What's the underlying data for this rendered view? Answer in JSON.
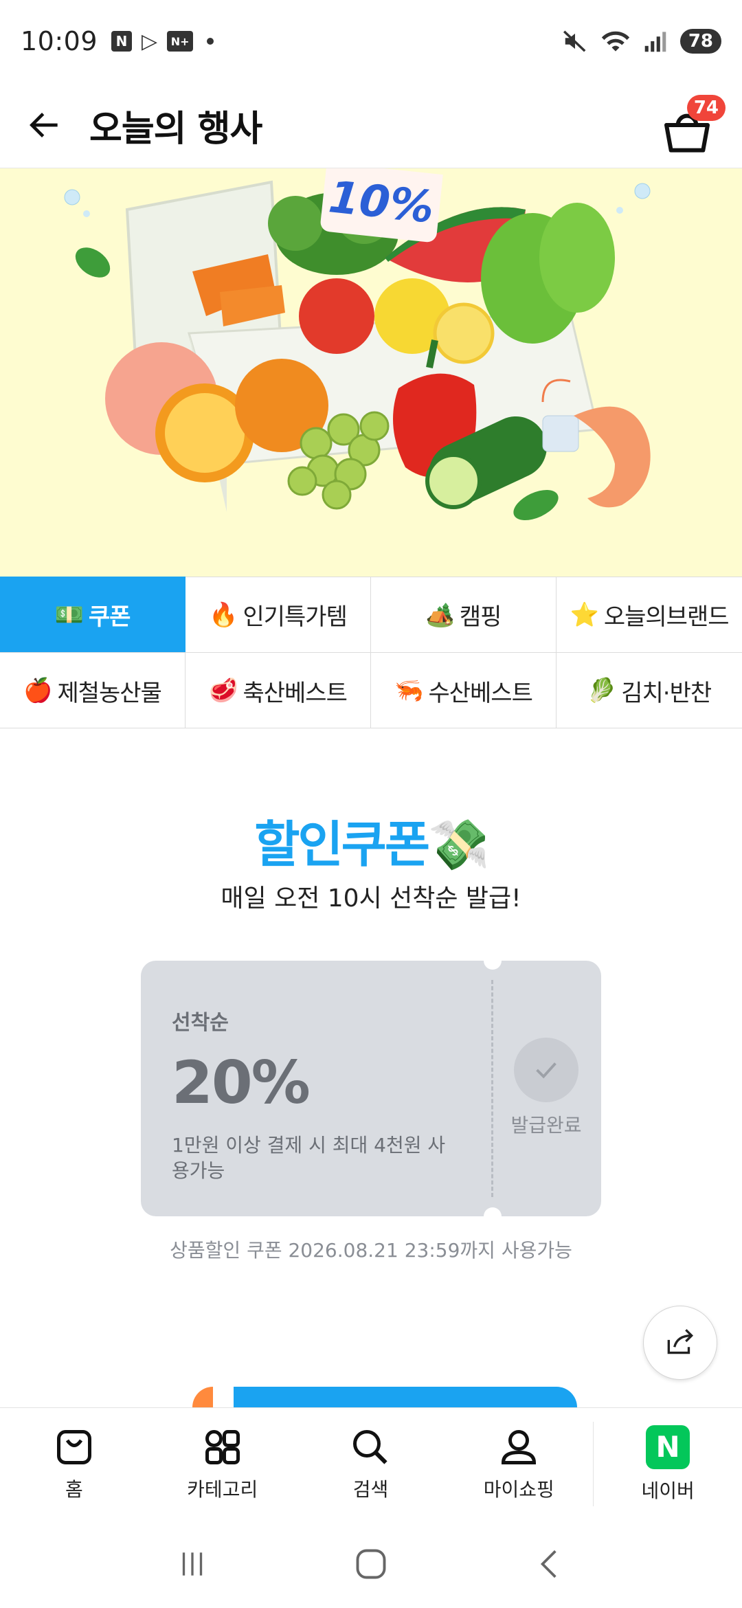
{
  "status_bar": {
    "time": "10:09",
    "notif_icons": [
      "N",
      "▷",
      "N+"
    ],
    "battery": "78"
  },
  "header": {
    "title": "오늘의 행사",
    "cart_count": "74"
  },
  "banner": {
    "discount_tag": "10%"
  },
  "categories": [
    {
      "emoji": "💵",
      "label": "쿠폰",
      "active": true
    },
    {
      "emoji": "🔥",
      "label": "인기특가템",
      "active": false
    },
    {
      "emoji": "🏕️",
      "label": "캠핑",
      "active": false
    },
    {
      "emoji": "⭐",
      "label": "오늘의브랜드",
      "active": false
    },
    {
      "emoji": "🍎",
      "label": "제철농산물",
      "active": false
    },
    {
      "emoji": "🥩",
      "label": "축산베스트",
      "active": false
    },
    {
      "emoji": "🦐",
      "label": "수산베스트",
      "active": false
    },
    {
      "emoji": "🥬",
      "label": "김치·반찬",
      "active": false
    }
  ],
  "coupon_section": {
    "title": "할인쿠폰💸",
    "subtitle": "매일 오전 10시 선착순 발급!",
    "card": {
      "label": "선착순",
      "percent": "20%",
      "desc": "1만원 이상 결제 시 최대 4천원 사용가능",
      "status": "발급완료"
    },
    "note": "상품할인 쿠폰 2026.08.21 23:59까지 사용가능"
  },
  "bottom_nav": [
    {
      "label": "홈",
      "icon": "home-bag-icon"
    },
    {
      "label": "카테고리",
      "icon": "category-grid-icon"
    },
    {
      "label": "검색",
      "icon": "search-icon"
    },
    {
      "label": "마이쇼핑",
      "icon": "person-icon"
    },
    {
      "label": "네이버",
      "icon": "naver-logo-icon"
    }
  ],
  "colors": {
    "accent": "#1aa3f1",
    "badge": "#f0453a",
    "naver_green": "#03c75a",
    "banner_bg": "#fefcd0"
  }
}
